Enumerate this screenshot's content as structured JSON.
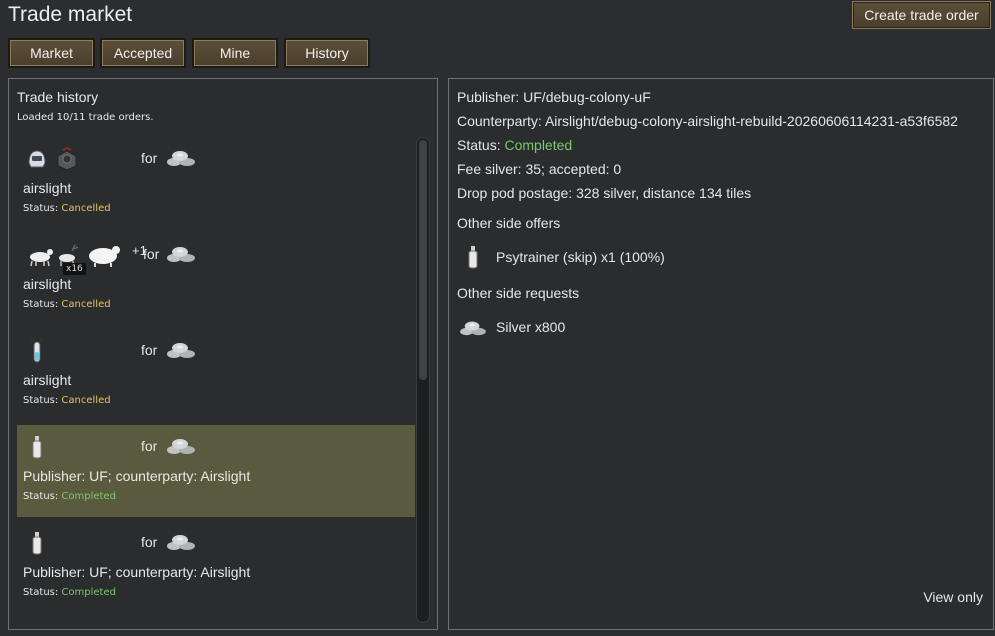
{
  "window": {
    "title": "Trade market"
  },
  "toolbar": {
    "create_label": "Create trade order"
  },
  "tabs": [
    {
      "label": "Market"
    },
    {
      "label": "Accepted"
    },
    {
      "label": "Mine"
    },
    {
      "label": "History"
    }
  ],
  "history": {
    "heading": "Trade history",
    "loaded_text": "Loaded 10/11 trade orders.",
    "for_label": "for",
    "status_prefix": "Status: ",
    "orders": [
      {
        "offer_icons": [
          "helmet-icon",
          "gear-block-icon"
        ],
        "request_icon": "silver-icon",
        "title": "airslight",
        "status": "Cancelled",
        "status_color": "#e6c35a"
      },
      {
        "offer_icons": [
          "goat-icon",
          "deer-icon",
          "sheep-icon"
        ],
        "quantity_badge": "x16",
        "extra_count": "+1",
        "request_icon": "silver-icon",
        "title": "airslight",
        "status": "Cancelled",
        "status_color": "#e6c35a"
      },
      {
        "offer_icons": [
          "serum-tube-icon"
        ],
        "request_icon": "silver-icon",
        "title": "airslight",
        "status": "Cancelled",
        "status_color": "#e6c35a"
      },
      {
        "offer_icons": [
          "psytrainer-icon"
        ],
        "request_icon": "silver-icon",
        "title": "Publisher: UF; counterparty: Airslight",
        "status": "Completed",
        "status_color": "#7cc86a",
        "selected": true
      },
      {
        "offer_icons": [
          "psytrainer-icon"
        ],
        "request_icon": "silver-icon",
        "title": "Publisher: UF; counterparty: Airslight",
        "status": "Completed",
        "status_color": "#7cc86a"
      }
    ]
  },
  "detail": {
    "publisher": "Publisher: UF/debug-colony-uF",
    "counterparty": "Counterparty: Airslight/debug-colony-airslight-rebuild-20260606114231-a53f6582",
    "status_label": "Status: ",
    "status_value": "Completed",
    "fee": "Fee silver: 35; accepted: 0",
    "postage": "Drop pod postage: 328 silver, distance 134 tiles",
    "offers_heading": "Other side offers",
    "offers": [
      {
        "icon": "psytrainer-icon",
        "text": "Psytrainer (skip) x1  (100%)"
      }
    ],
    "requests_heading": "Other side requests",
    "requests": [
      {
        "icon": "silver-icon",
        "text": "Silver x800"
      }
    ],
    "view_only": "View only"
  },
  "colors": {
    "completed": "#7cc86a",
    "cancelled": "#e6c35a",
    "selected_row": "#595a3e",
    "button": "#5c4f39"
  }
}
